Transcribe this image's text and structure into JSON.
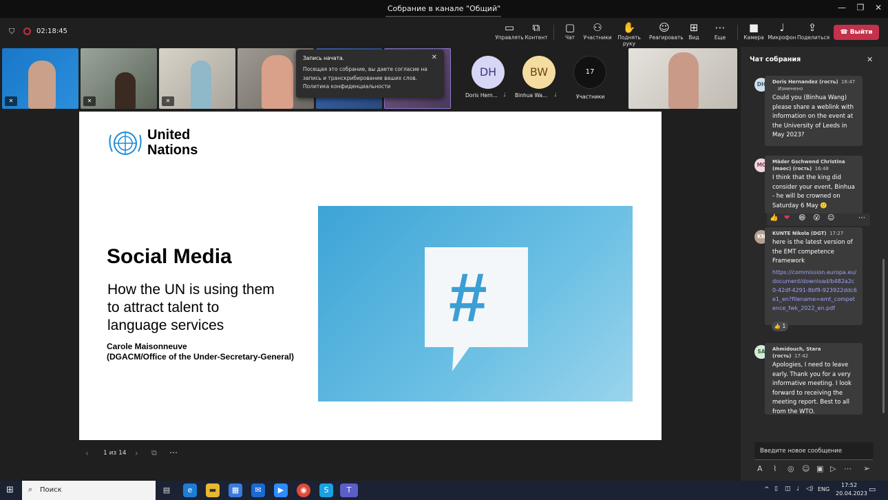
{
  "window": {
    "title": "Собрание в канале \"Общий\"",
    "minimize": "—",
    "maximize": "❐",
    "close": "✕"
  },
  "meeting": {
    "timer": "02:18:45"
  },
  "toolbar": {
    "manage": "Управлять",
    "content": "Контент",
    "chat": "Чат",
    "participants": "Участники",
    "raise_hand": "Поднять руку",
    "react": "Реагировать",
    "view": "Вид",
    "more": "Еще",
    "camera": "Камера",
    "mic": "Микрофон",
    "share": "Поделиться",
    "leave": "Выйти"
  },
  "recording_toast": {
    "title": "Запись начата.",
    "body": "Посещая это собрание, вы даете согласие на запись и транскрибирование ваших слов.",
    "link": "Политика конфиденциальности"
  },
  "participants": [
    {
      "initials": "DH",
      "name": "Doris Hern...",
      "color": "#d8d6f5",
      "text_color": "#3a3a7a"
    },
    {
      "initials": "BW",
      "name": "Binhua Wa...",
      "color": "#f5dca0",
      "text_color": "#6a4a10"
    }
  ],
  "participants_count": {
    "count": "17",
    "label": "Участники"
  },
  "slide": {
    "org_line1": "United",
    "org_line2": "Nations",
    "title": "Social Media",
    "subtitle_1": "How the UN is using them",
    "subtitle_2": "to attract talent to",
    "subtitle_3": "language services",
    "author": "Carole Maisonneuve",
    "office": "(DGACM/Office of the Under-Secretary-General)",
    "hashtag": "#"
  },
  "slide_nav": {
    "page": "1 из 14"
  },
  "chat": {
    "title": "Чат собрания",
    "messages": [
      {
        "initials": "DH",
        "author": "Doris Hernandez (гость)",
        "time": "16:47",
        "edited": "Изменено",
        "text": "Could you (Binhua Wang) please share a weblink with information on the event at the University of Leeds in May 2023?"
      },
      {
        "initials": "MC",
        "author": "Mäder Gschwend Christina (maес) (гость)",
        "time": "16:48",
        "text": "I think that the king did consider your event, Binhua - he will be crowned on Saturday 6 May 🙂"
      },
      {
        "initials": "KN",
        "author": "KUNTE Nikola (DGT)",
        "time": "17:27",
        "text": "here is the latest version of the EMT competence Framework",
        "link": "https://commission.europa.eu/document/download/b482a2c0-42df-4291-8bf8-923922ddc6e1_en?filename=emt_competence_fwk_2022_en.pdf",
        "reaction": "👍 1"
      },
      {
        "initials": "SA",
        "author": "Ahmidouch, Stara (гость)",
        "time": "17:42",
        "text": "Apologies, I need to leave early. Thank you for a very informative meeting. I look forward to receiving the meeting report. Best to all  from the WTO."
      }
    ],
    "reactions": [
      "👍",
      "❤",
      "😆",
      "😮",
      "☺",
      "⋯"
    ],
    "input_placeholder": "Введите новое сообщение"
  },
  "taskbar": {
    "search": "Поиск",
    "lang": "ENG",
    "time": "17:52",
    "date": "20.04.2023"
  }
}
